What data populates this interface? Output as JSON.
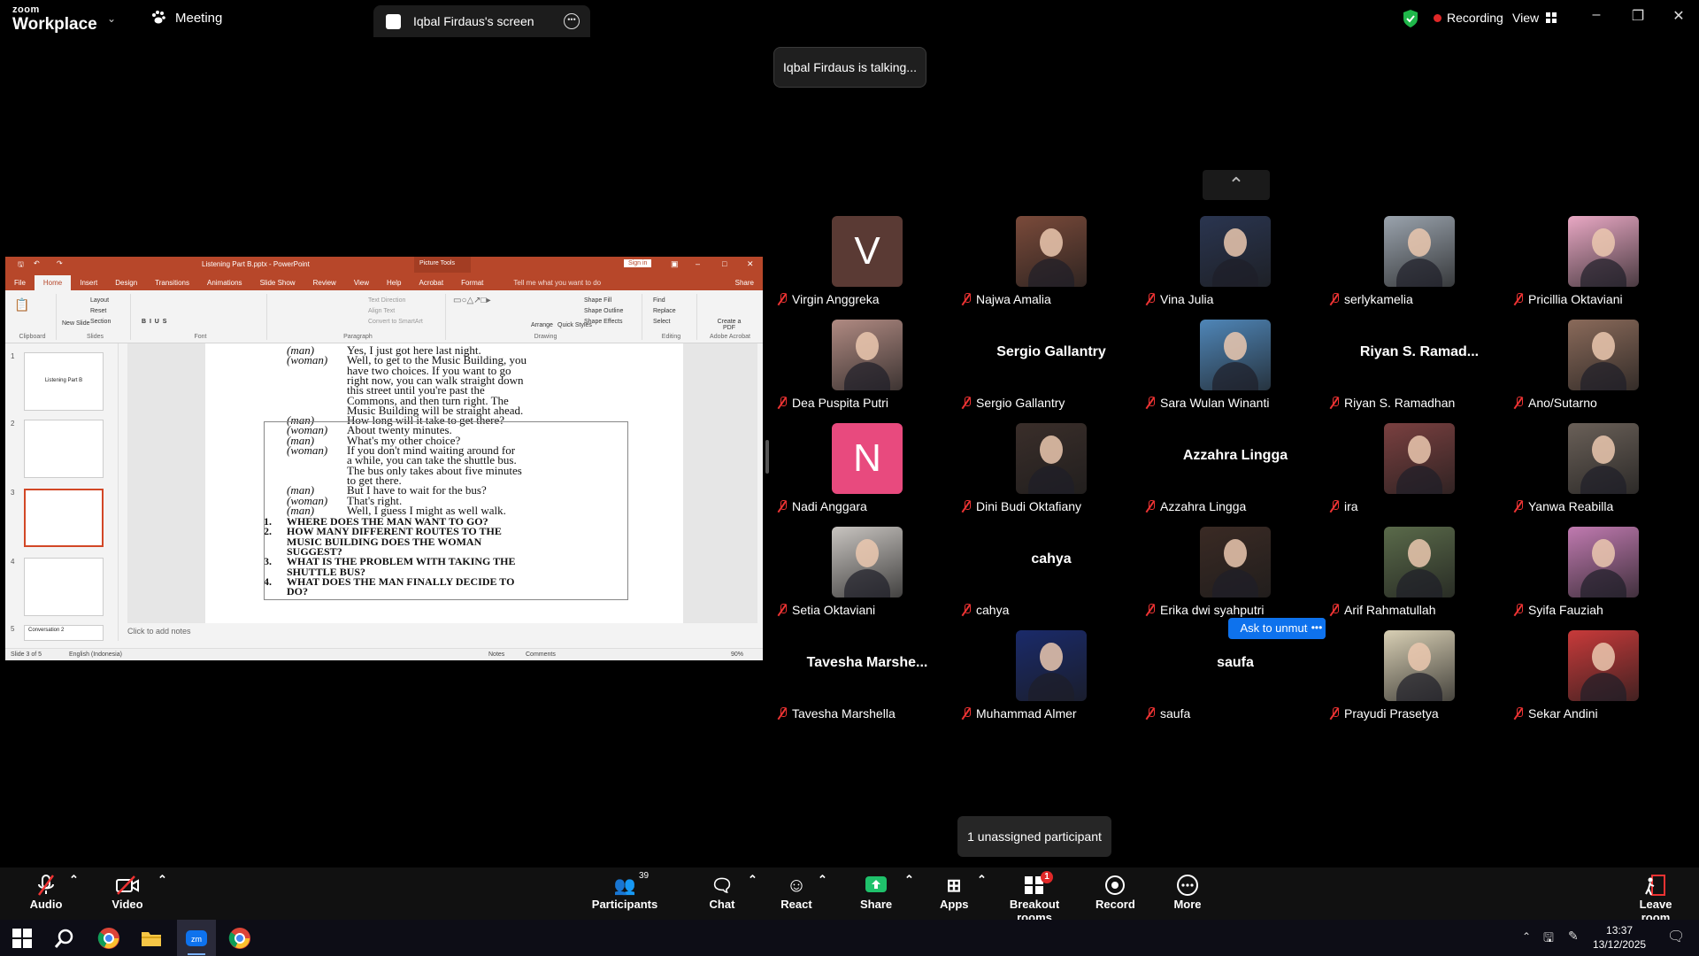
{
  "app": {
    "brand_small": "zoom",
    "brand_large": "Workplace",
    "meeting_label": "Meeting",
    "screen_tab": "Iqbal Firdaus's screen",
    "recording": "Recording",
    "view": "View",
    "talking": "Iqbal Firdaus is talking..."
  },
  "ppt": {
    "title": "Listening Part B.pptx - PowerPoint",
    "picture_tools": "Picture Tools",
    "sign_in": "Sign in",
    "share": "Share",
    "tabs": [
      "File",
      "Home",
      "Insert",
      "Design",
      "Transitions",
      "Animations",
      "Slide Show",
      "Review",
      "View",
      "Help",
      "Acrobat",
      "Format"
    ],
    "tell_me": "Tell me what you want to do",
    "ribbon": {
      "clipboard": "Clipboard",
      "slides": "Slides",
      "font": "Font",
      "paragraph": "Paragraph",
      "drawing": "Drawing",
      "editing": "Editing",
      "adobe": "Adobe Acrobat",
      "new_slide": "New Slide",
      "layout": "Layout",
      "reset": "Reset",
      "section": "Section",
      "text_direction": "Text Direction",
      "align_text": "Align Text",
      "convert_smartart": "Convert to SmartArt",
      "arrange": "Arrange",
      "quick_styles": "Quick Styles",
      "shape_fill": "Shape Fill",
      "shape_outline": "Shape Outline",
      "shape_effects": "Shape Effects",
      "find": "Find",
      "replace": "Replace",
      "select": "Select",
      "create_pdf": "Create a PDF"
    },
    "thumbnails": [
      {
        "num": "1",
        "text": "Listening Part B"
      },
      {
        "num": "2",
        "text": ""
      },
      {
        "num": "3",
        "text": ""
      },
      {
        "num": "4",
        "text": ""
      },
      {
        "num": "5",
        "text": "Conversation 2"
      }
    ],
    "slide_lines": [
      {
        "speaker": "(man)",
        "text": "Yes, I just got here last night."
      },
      {
        "speaker": "(woman)",
        "text": "Well, to get to the Music Building, you"
      },
      {
        "speaker": "",
        "text": "have two choices. If you want to go"
      },
      {
        "speaker": "",
        "text": "right now, you can walk straight down"
      },
      {
        "speaker": "",
        "text": "this street until you're past the"
      },
      {
        "speaker": "",
        "text": "Commons, and then turn right. The"
      },
      {
        "speaker": "",
        "text": "Music Building will be straight ahead."
      },
      {
        "speaker": "(man)",
        "text": "How long will it take to get there?"
      },
      {
        "speaker": "(woman)",
        "text": "About twenty minutes."
      },
      {
        "speaker": "(man)",
        "text": "What's my other choice?"
      },
      {
        "speaker": "(woman)",
        "text": "If you don't mind waiting around for"
      },
      {
        "speaker": "",
        "text": "a while, you can take the shuttle bus."
      },
      {
        "speaker": "",
        "text": "The bus only takes about five minutes"
      },
      {
        "speaker": "",
        "text": "to get there."
      },
      {
        "speaker": "(man)",
        "text": "But I have to wait for the bus?"
      },
      {
        "speaker": "(woman)",
        "text": "That's right."
      },
      {
        "speaker": "(man)",
        "text": "Well, I guess I might as well walk."
      }
    ],
    "questions": [
      {
        "num": "1.",
        "text": "WHERE DOES THE MAN WANT TO GO?"
      },
      {
        "num": "2.",
        "text": "HOW MANY DIFFERENT ROUTES TO THE"
      },
      {
        "num": "",
        "text": "MUSIC BUILDING DOES THE WOMAN"
      },
      {
        "num": "",
        "text": "SUGGEST?"
      },
      {
        "num": "3.",
        "text": "WHAT IS THE PROBLEM WITH TAKING THE"
      },
      {
        "num": "",
        "text": "SHUTTLE BUS?"
      },
      {
        "num": "4.",
        "text": "WHAT DOES THE MAN FINALLY DECIDE TO"
      },
      {
        "num": "",
        "text": "DO?"
      }
    ],
    "notes_placeholder": "Click to add notes",
    "status": {
      "slide": "Slide 3 of 5",
      "language": "English (Indonesia)",
      "notes": "Notes",
      "comments": "Comments",
      "zoom": "90%"
    }
  },
  "participants": [
    {
      "name": "Virgin Anggreka",
      "type": "initial",
      "initial": "V",
      "bg": "#5a3a34"
    },
    {
      "name": "Najwa Amalia",
      "type": "photo",
      "bg": "#7a4a3a"
    },
    {
      "name": "Vina Julia",
      "type": "photo",
      "bg": "#2a3550"
    },
    {
      "name": "serlykamelia",
      "type": "photo",
      "bg": "#9aa3ad"
    },
    {
      "name": "Pricillia Oktaviani",
      "type": "photo",
      "bg": "#e9a8c4"
    },
    {
      "name": "Dea Puspita Putri",
      "type": "photo",
      "bg": "#b08a82"
    },
    {
      "name": "Sergio Gallantry",
      "type": "name",
      "display": "Sergio Gallantry"
    },
    {
      "name": "Sara Wulan Winanti",
      "type": "photo",
      "bg": "#4f86b8"
    },
    {
      "name": "Riyan S. Ramadhan",
      "type": "name",
      "display": "Riyan S. Ramad..."
    },
    {
      "name": "Ano/Sutarno",
      "type": "photo",
      "bg": "#8a6a5a"
    },
    {
      "name": "Nadi Anggara",
      "type": "initial",
      "initial": "N",
      "bg": "#e84a7e"
    },
    {
      "name": "Dini Budi Oktafiany",
      "type": "photo",
      "bg": "#3a2e2a"
    },
    {
      "name": "Azzahra Lingga",
      "type": "name",
      "display": "Azzahra Lingga"
    },
    {
      "name": "ira",
      "type": "photo",
      "bg": "#7a4040"
    },
    {
      "name": "Yanwa Reabilla",
      "type": "photo",
      "bg": "#6a6058"
    },
    {
      "name": "Setia Oktaviani",
      "type": "photo",
      "bg": "#c8c4c0"
    },
    {
      "name": "cahya",
      "type": "name",
      "display": "cahya"
    },
    {
      "name": "Erika dwi syahputri",
      "type": "photo",
      "bg": "#3a2a24"
    },
    {
      "name": "Arif Rahmatullah",
      "type": "photo",
      "bg": "#5a6a4a"
    },
    {
      "name": "Syifa Fauziah",
      "type": "photo",
      "bg": "#c07ab0"
    },
    {
      "name": "Tavesha Marshella",
      "type": "name",
      "display": "Tavesha Marshe..."
    },
    {
      "name": "Muhammad Almer",
      "type": "photo",
      "bg": "#1a2a6a"
    },
    {
      "name": "saufa",
      "type": "name",
      "display": "saufa"
    },
    {
      "name": "Prayudi Prasetya",
      "type": "photo",
      "bg": "#d8cfb4"
    },
    {
      "name": "Sekar Andini",
      "type": "photo",
      "bg": "#c83a3a"
    }
  ],
  "ask_to_unmute": "Ask to unmute",
  "unassigned": "1 unassigned participant",
  "toolbar": {
    "audio": "Audio",
    "video": "Video",
    "participants": "Participants",
    "participants_count": "39",
    "chat": "Chat",
    "react": "React",
    "share": "Share",
    "apps": "Apps",
    "breakout": "Breakout rooms",
    "breakout_badge": "1",
    "record": "Record",
    "more": "More",
    "leave": "Leave room"
  },
  "taskbar": {
    "time": "13:37",
    "date": "13/12/2025"
  },
  "colors": {
    "ppt_accent": "#b7472a",
    "zoom_blue": "#0e72ed",
    "share_green": "#1fc16b",
    "recording_red": "#e02828"
  }
}
